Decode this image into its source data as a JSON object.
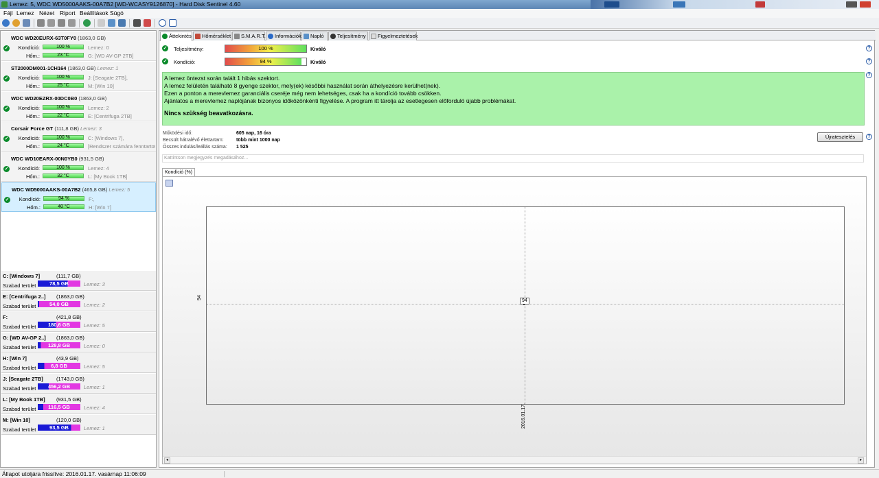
{
  "window": {
    "title": "Lemez: 5, WDC WD5000AAKS-00A7B2 [WD-WCASY9126870]  -  Hard Disk Sentinel 4.60"
  },
  "menu": [
    "Fájl",
    "Lemez",
    "Nézet",
    "Riport",
    "Beállítások",
    "Súgó"
  ],
  "disks": [
    {
      "name": "WDC WD20EURX-63T0FY0",
      "size": "(1863,0 GB)",
      "lemez": "",
      "kond": "100 %",
      "hom": "23 °C",
      "info1": "Lemez: 0",
      "info2": "G: [WD AV-GP 2TB]"
    },
    {
      "name": "ST2000DM001-1CH164",
      "size": "(1863,0 GB)",
      "lemez": "Lemez: 1",
      "kond": "100 %",
      "hom": "25 °C",
      "info1": "J: [Seagate 2TB],",
      "info2": "M: [Win 10]"
    },
    {
      "name": "WDC WD20EZRX-00DC0B0",
      "size": "(1863,0 GB)",
      "lemez": "",
      "kond": "100 %",
      "hom": "22 °C",
      "info1": "Lemez: 2",
      "info2": "E: [Centrifuga 2TB]"
    },
    {
      "name": "Corsair Force GT",
      "size": "(111,8 GB)",
      "lemez": "Lemez: 3",
      "kond": "100 %",
      "hom": "24 °C",
      "info1": "C: [Windows 7],",
      "info2": "[Rendszer számára fenntartott]"
    },
    {
      "name": "WDC WD10EARX-00N0YB0",
      "size": "(931,5 GB)",
      "lemez": "",
      "kond": "100 %",
      "hom": "32 °C",
      "info1": "Lemez: 4",
      "info2": "L: [My Book 1TB]"
    },
    {
      "name": "WDC WD5000AAKS-00A7B2",
      "size": "(465,8 GB)",
      "lemez": "Lemez: 5",
      "kond": "94 %",
      "hom": "40 °C",
      "info1": "F:,",
      "info2": "H: [Win 7]"
    }
  ],
  "labels": {
    "kondicio": "Kondíció:",
    "hom": "Hőm.:",
    "szabad": "Szabad terület"
  },
  "partitions": [
    {
      "name": "C: [Windows 7]",
      "size": "(111,7 GB)",
      "free": "78,5 GB",
      "lemez": "Lemez: 3",
      "fill": 0.7
    },
    {
      "name": "E: [Centrifuga 2..]",
      "size": "(1863,0 GB)",
      "free": "54,0 GB",
      "lemez": "Lemez: 2",
      "fill": 0.03
    },
    {
      "name": "F:",
      "size": "(421,8 GB)",
      "free": "180,6 GB",
      "lemez": "Lemez: 5",
      "fill": 0.43
    },
    {
      "name": "G: [WD AV-GP 2..]",
      "size": "(1863,0 GB)",
      "free": "128,8 GB",
      "lemez": "Lemez: 0",
      "fill": 0.07
    },
    {
      "name": "H: [Win 7]",
      "size": "(43,9 GB)",
      "free": "6,8 GB",
      "lemez": "Lemez: 5",
      "fill": 0.15
    },
    {
      "name": "J: [Seagate 2TB]",
      "size": "(1743,0 GB)",
      "free": "456,2 GB",
      "lemez": "Lemez: 1",
      "fill": 0.26
    },
    {
      "name": "L: [My Book 1TB]",
      "size": "(931,5 GB)",
      "free": "116,5 GB",
      "lemez": "Lemez: 4",
      "fill": 0.13
    },
    {
      "name": "M: [Win 10]",
      "size": "(120,0 GB)",
      "free": "93,5 GB",
      "lemez": "Lemez: 1",
      "fill": 0.78
    }
  ],
  "tabs": [
    "Áttekintés",
    "Hőmérséklet",
    "S.M.A.R.T.",
    "Információk",
    "Napló",
    "Teljesítmény",
    "Figyelmeztetések"
  ],
  "overview": {
    "perf_label": "Teljesítmény:",
    "perf_value": "100 %",
    "perf_rating": "Kiváló",
    "cond_label": "Kondíció:",
    "cond_value": "94 %",
    "cond_rating": "Kiváló",
    "msg": [
      "A lemez öntezst során talált 1 hibás szektort.",
      "A lemez felületén található 8 gyenge szektor, mely(ek) későbbi használat során áthelyezésre kerülhet(nek).",
      "Ezen a ponton a merevlemez garanciális cseréje még nem lehetséges, csak ha a kondíció tovább csökken.",
      "Ajánlatos a merevlemez naplójának bizonyos időközönkénti figyelése. A program itt tárolja az esetlegesen előforduló újabb problémákat."
    ],
    "msg_bold": "Nincs szükség beavatkozásra.",
    "uptime_label": "Működési idő:",
    "uptime": "605 nap, 16 óra",
    "life_label": "Becsült hátralévő élettartam:",
    "life": "több mint 1000 nap",
    "starts_label": "Összes indulás/leállás száma:",
    "starts": "1 525",
    "retest": "Újratesztelés",
    "note_placeholder": "Kattintson megjegyzés megadásához..."
  },
  "chart_tab": "Kondíció  (%)",
  "chart_data": {
    "type": "line",
    "x": [
      "2016.01.17."
    ],
    "series": [
      {
        "values": [
          94
        ]
      }
    ],
    "ytick": "94",
    "point_label": "94"
  },
  "status": "Állapot utoljára frissítve: 2016.01.17. vasárnap 11:06:09"
}
